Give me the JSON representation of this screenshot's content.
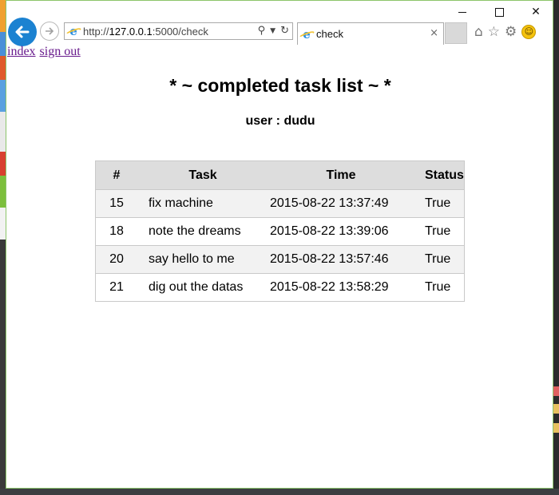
{
  "browser": {
    "url_prefix": "http://",
    "url_host": "127.0.0.1",
    "url_rest": ":5000/check",
    "tab_title": "check",
    "tab_close": "×"
  },
  "nav_links": {
    "index": "index",
    "sign_out": "sign out"
  },
  "page": {
    "heading": "* ~ completed task list ~ *",
    "user_line": "user : dudu"
  },
  "table": {
    "headers": [
      "#",
      "Task",
      "Time",
      "Status"
    ],
    "rows": [
      {
        "num": "15",
        "task": "fix machine",
        "time": "2015-08-22 13:37:49",
        "status": "True"
      },
      {
        "num": "18",
        "task": "note the dreams",
        "time": "2015-08-22 13:39:06",
        "status": "True"
      },
      {
        "num": "20",
        "task": "say hello to me",
        "time": "2015-08-22 13:57:46",
        "status": "True"
      },
      {
        "num": "21",
        "task": "dig out the datas",
        "time": "2015-08-22 13:58:29",
        "status": "True"
      }
    ]
  },
  "icons": {
    "back": "back-arrow-icon",
    "forward": "forward-arrow-icon",
    "search": "search-icon",
    "refresh": "refresh-icon",
    "home": "home-icon",
    "favorites": "star-icon",
    "settings": "gear-icon",
    "feedback": "smiley-icon"
  },
  "colors": {
    "back_button": "#1b82d1",
    "visited_link": "#681a8c",
    "header_row": "#dddddd",
    "window_border": "#8cc56a"
  }
}
